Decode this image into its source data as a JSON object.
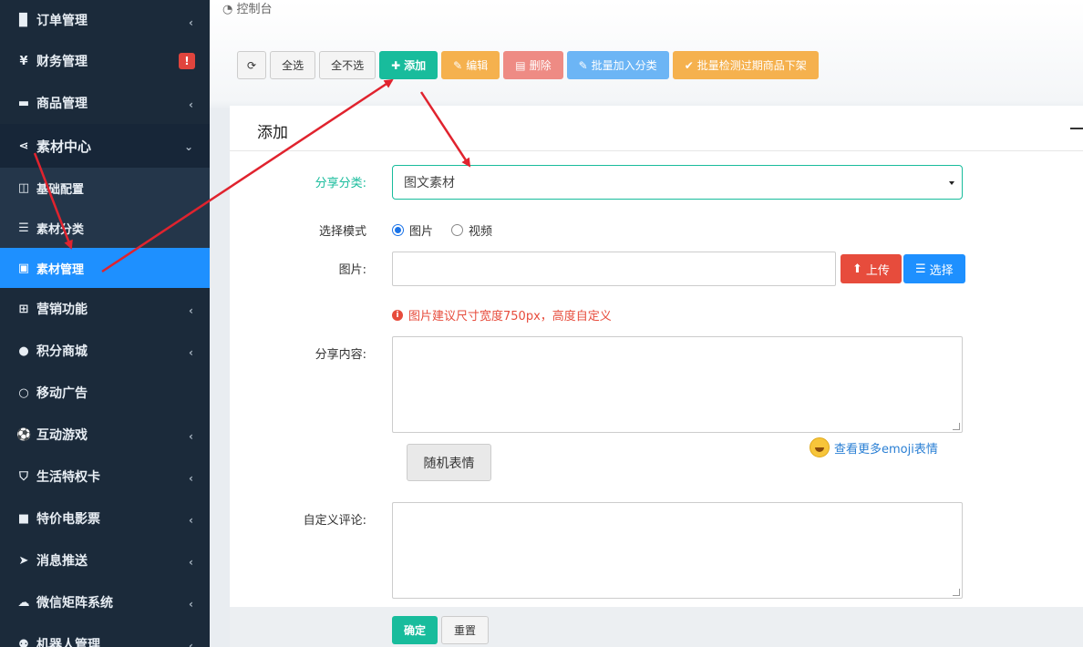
{
  "sidebar": {
    "items": [
      {
        "label": "订单管理",
        "icon": "file-icon"
      },
      {
        "label": "财务管理",
        "icon": "yen-icon",
        "badge": "!"
      },
      {
        "label": "商品管理",
        "icon": "briefcase-icon"
      },
      {
        "label": "素材中心",
        "icon": "share-icon",
        "open": true
      },
      {
        "label": "营销功能",
        "icon": "gift-icon"
      },
      {
        "label": "积分商城",
        "icon": "circle-plus-icon"
      },
      {
        "label": "移动广告",
        "icon": "ring-icon"
      },
      {
        "label": "互动游戏",
        "icon": "soccer-icon"
      },
      {
        "label": "生活特权卡",
        "icon": "badge-icon"
      },
      {
        "label": "特价电影票",
        "icon": "video-icon"
      },
      {
        "label": "消息推送",
        "icon": "paper-plane-icon"
      },
      {
        "label": "微信矩阵系统",
        "icon": "wechat-icon"
      },
      {
        "label": "机器人管理",
        "icon": "robot-icon"
      }
    ],
    "subitems": [
      {
        "label": "基础配置",
        "icon": "columns-icon"
      },
      {
        "label": "素材分类",
        "icon": "list-icon"
      },
      {
        "label": "素材管理",
        "icon": "image-icon",
        "active": true
      }
    ]
  },
  "breadcrumb": "控制台",
  "toolbar": {
    "refresh": "",
    "select_all": "全选",
    "deselect_all": "全不选",
    "add": "添加",
    "edit": "编辑",
    "delete": "删除",
    "batch_category": "批量加入分类",
    "batch_check": "批量检测过期商品下架"
  },
  "panel": {
    "title": "添加",
    "share_category_label": "分享分类:",
    "share_category_value": "图文素材",
    "mode_label": "选择模式",
    "mode_options": [
      "图片",
      "视频"
    ],
    "mode_selected": "图片",
    "image_label": "图片:",
    "upload_label": "上传",
    "choose_label": "选择",
    "hint": "图片建议尺寸宽度750px，高度自定义",
    "content_label": "分享内容:",
    "emoji_link": "查看更多emoji表情",
    "random_emoji": "随机表情",
    "comment_label": "自定义评论:",
    "ok": "确定",
    "reset": "重置"
  },
  "colors": {
    "sidebar_bg": "#1b2a3a",
    "active": "#1e90ff",
    "primary": "#18bc9c",
    "danger": "#e74c3c",
    "arrow": "#e0232e"
  }
}
